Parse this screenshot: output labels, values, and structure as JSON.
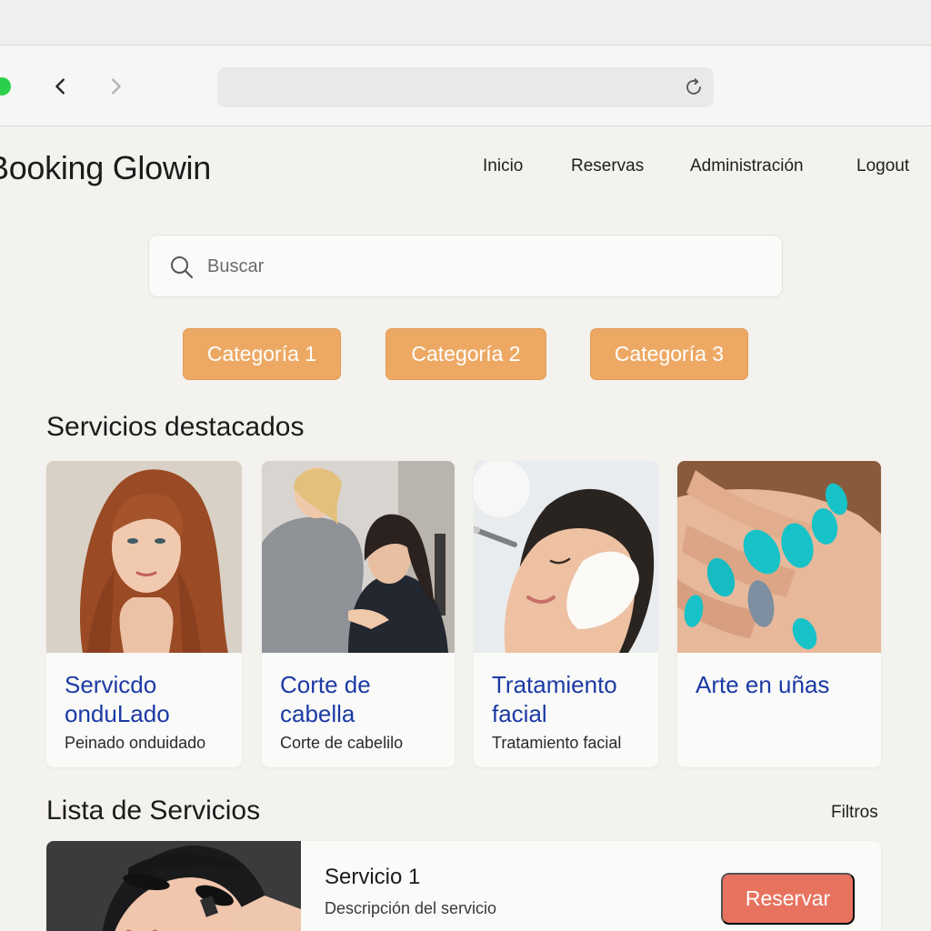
{
  "browser": {
    "back_icon": "chevron-left-icon",
    "forward_icon": "chevron-right-icon",
    "reload_icon": "reload-icon",
    "address": ""
  },
  "app": {
    "title": "Booking Glowin"
  },
  "nav": {
    "items": [
      {
        "label": "Inicio"
      },
      {
        "label": "Reservas"
      },
      {
        "label": "Administración"
      },
      {
        "label": "Logout"
      }
    ]
  },
  "search": {
    "placeholder": "Buscar",
    "value": ""
  },
  "categories": [
    {
      "label": "Categoría 1"
    },
    {
      "label": "Categoría 2"
    },
    {
      "label": "Categoría 3"
    }
  ],
  "featured": {
    "title": "Servicios destacados",
    "cards": [
      {
        "title": "Servicdo onduLado",
        "subtitle": "Peinado onduidado",
        "image": "redhead-portrait-photo"
      },
      {
        "title": "Corte de cabella",
        "subtitle": "Corte de  cabelilo",
        "image": "hairdresser-photo"
      },
      {
        "title": "Tratamiento facial",
        "subtitle": "Tratamiento facial",
        "image": "facial-mask-photo"
      },
      {
        "title": "Arte en uñas",
        "subtitle": "",
        "image": "turquoise-nails-photo"
      }
    ]
  },
  "services_list": {
    "title": "Lista de Servicios",
    "filters_label": "Filtros",
    "items": [
      {
        "title": "Servicio 1",
        "description": "Descripción del servicio",
        "action_label": "Reservar",
        "image": "lash-treatment-photo"
      }
    ]
  },
  "colors": {
    "background": "#f4f2ee",
    "category_button": "#eda964",
    "card_title": "#1c3aa5",
    "reserve_button": "#e7735f"
  }
}
